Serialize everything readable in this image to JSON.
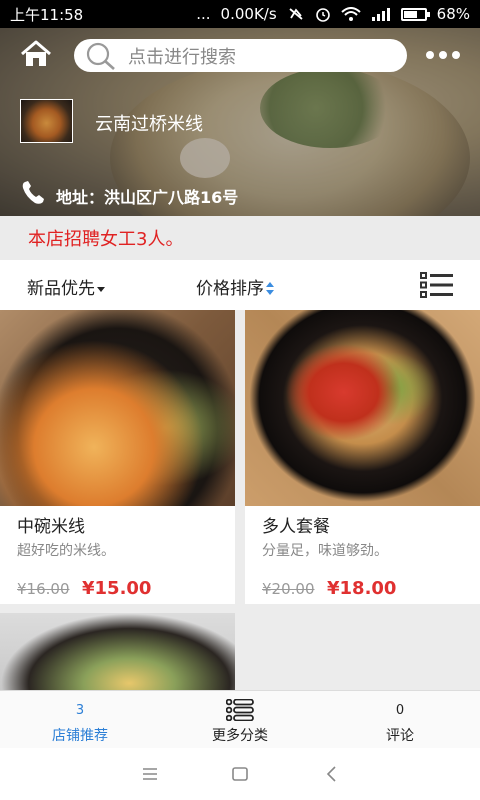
{
  "status_bar": {
    "time": "上午11:58",
    "dots": "...",
    "speed": "0.00K/s",
    "battery": "68%",
    "battery_level": 0.68
  },
  "header": {
    "search_placeholder": "点击进行搜索",
    "shop_name": "云南过桥米线",
    "address": "地址：洪山区广八路16号"
  },
  "notice": "本店招聘女工3人。",
  "sort": {
    "newest": "新品优先",
    "price": "价格排序"
  },
  "products": [
    {
      "name": "中碗米线",
      "desc": "超好吃的米线。",
      "old_price": "¥16.00",
      "price": "¥15.00"
    },
    {
      "name": "多人套餐",
      "desc": "分量足，味道够劲。",
      "old_price": "¥20.00",
      "price": "¥18.00"
    },
    {
      "name": "",
      "desc": "",
      "old_price": "",
      "price": ""
    }
  ],
  "tabs": [
    {
      "count": "3",
      "label": "店铺推荐"
    },
    {
      "count": "",
      "label": "更多分类"
    },
    {
      "count": "0",
      "label": "评论"
    }
  ],
  "colors": {
    "accent": "#2c7fd6",
    "price": "#e03030",
    "notice": "#e02222"
  }
}
